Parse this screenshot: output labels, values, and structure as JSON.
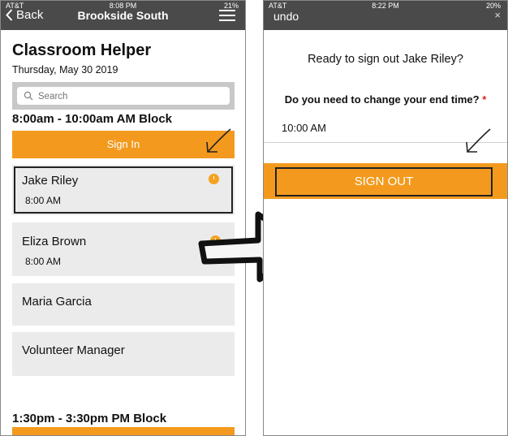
{
  "left": {
    "status": {
      "carrier": "AT&T",
      "time": "8:08 PM",
      "battery": "21%"
    },
    "nav": {
      "back_label": "Back",
      "title": "Brookside South"
    },
    "app_title": "Classroom Helper",
    "date": "Thursday, May 30 2019",
    "search": {
      "placeholder": "Search"
    },
    "blocks": [
      {
        "title": "8:00am - 10:00am AM Block",
        "button_label": "Sign In",
        "people": [
          {
            "name": "Jake Riley",
            "time": "8:00 AM"
          },
          {
            "name": "Eliza Brown",
            "time": "8:00 AM"
          },
          {
            "name": "Maria Garcia"
          },
          {
            "name": "Volunteer Manager"
          }
        ]
      },
      {
        "title": "1:30pm - 3:30pm PM Block"
      }
    ]
  },
  "right": {
    "status": {
      "carrier": "AT&T",
      "time": "8:22 PM",
      "battery": "20%"
    },
    "nav": {
      "undo_label": "undo",
      "close": "×"
    },
    "confirm_text": "Ready to sign out Jake Riley?",
    "question": "Do you need to change your end time?",
    "required_mark": "*",
    "end_time": "10:00 AM",
    "button_label": "SIGN OUT"
  },
  "colors": {
    "accent": "#f39a1e",
    "nav": "#4a4a4a",
    "card": "#ebebeb"
  }
}
